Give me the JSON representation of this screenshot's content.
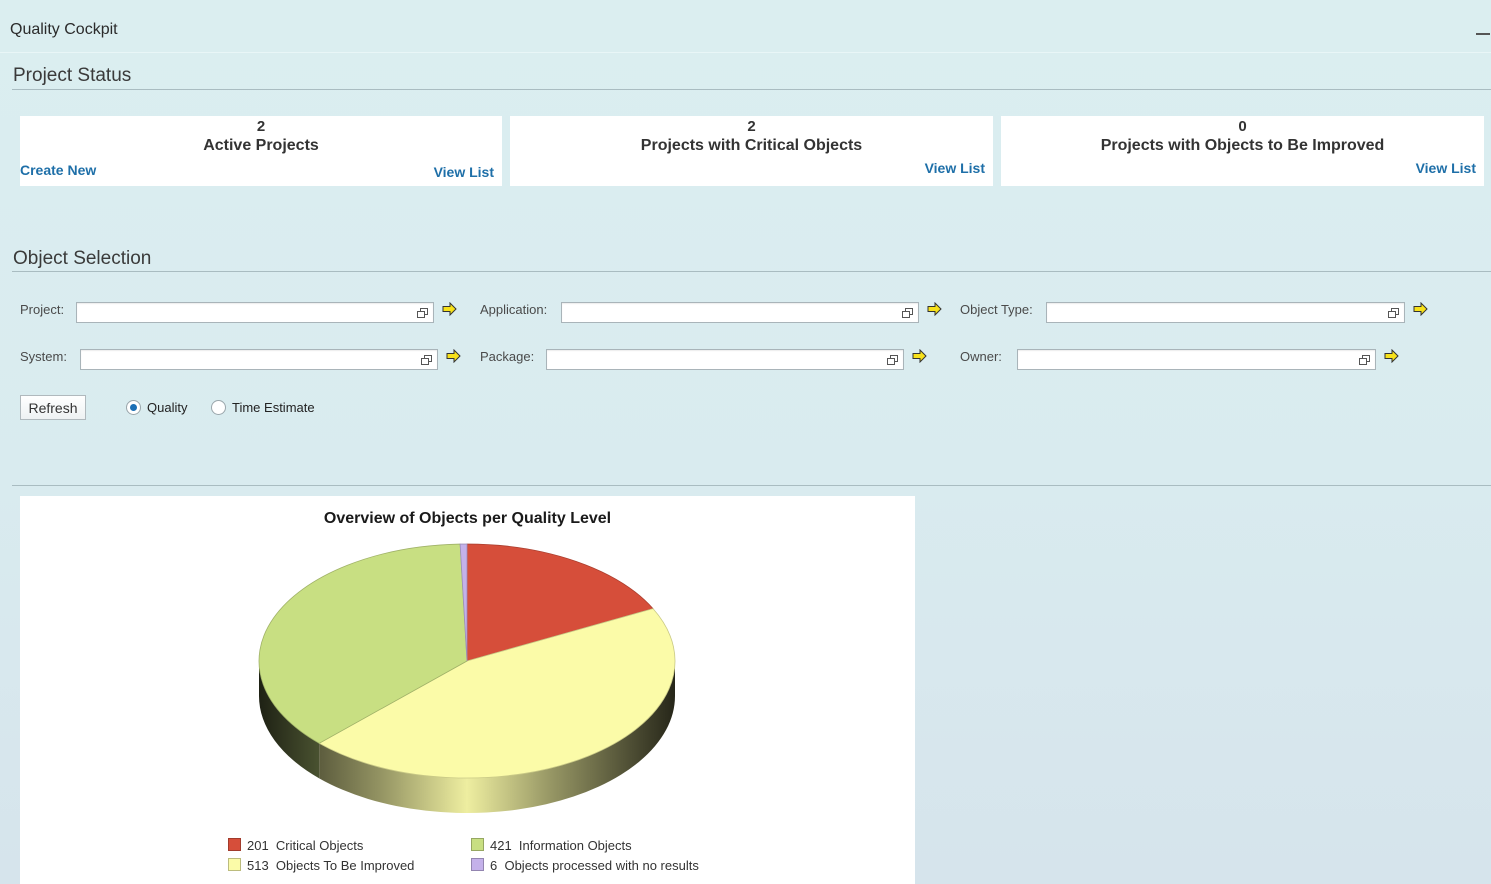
{
  "window": {
    "title": "Quality Cockpit"
  },
  "project_status": {
    "title": "Project Status",
    "tiles": [
      {
        "count": "2",
        "label": "Active Projects",
        "link_left": "Create New",
        "link_right": "View List"
      },
      {
        "count": "2",
        "label": "Projects with Critical Objects",
        "link_right": "View List"
      },
      {
        "count": "0",
        "label": "Projects with Objects to Be Improved",
        "link_right": "View List"
      }
    ]
  },
  "object_selection": {
    "title": "Object Selection",
    "fields": {
      "project": {
        "label": "Project:",
        "value": ""
      },
      "application": {
        "label": "Application:",
        "value": ""
      },
      "object_type": {
        "label": "Object Type:",
        "value": ""
      },
      "system": {
        "label": "System:",
        "value": ""
      },
      "package": {
        "label": "Package:",
        "value": ""
      },
      "owner": {
        "label": "Owner:",
        "value": ""
      }
    },
    "refresh_label": "Refresh",
    "radio": {
      "options": [
        {
          "label": "Quality",
          "selected": true
        },
        {
          "label": "Time Estimate",
          "selected": false
        }
      ]
    }
  },
  "icons": {
    "minimize": "minimize-icon",
    "value_help": "value-help-icon",
    "go": "go-arrow-icon"
  },
  "colors": {
    "link": "#1e6fa8",
    "critical": "#d64e3a",
    "information": "#c8df82",
    "improve": "#fbfba8",
    "no_result": "#c4b1ea"
  },
  "chart_data": {
    "type": "pie",
    "title": "Overview of Objects per Quality Level",
    "slices": [
      {
        "label": "Critical Objects",
        "value": 201,
        "color": "#d64e3a"
      },
      {
        "label": "Objects To Be Improved",
        "value": 513,
        "color": "#fbfba8"
      },
      {
        "label": "Information Objects",
        "value": 421,
        "color": "#c8df82"
      },
      {
        "label": "Objects processed with no results",
        "value": 6,
        "color": "#c4b1ea"
      }
    ],
    "legend": [
      {
        "value": "201",
        "label": "Critical Objects",
        "color": "#d64e3a"
      },
      {
        "value": "421",
        "label": "Information Objects",
        "color": "#c8df82"
      },
      {
        "value": "513",
        "label": "Objects To Be Improved",
        "color": "#fbfba8"
      },
      {
        "value": "6",
        "label": "Objects processed with no results",
        "color": "#c4b1ea"
      }
    ],
    "legend_position": "bottom",
    "style": "3d"
  }
}
